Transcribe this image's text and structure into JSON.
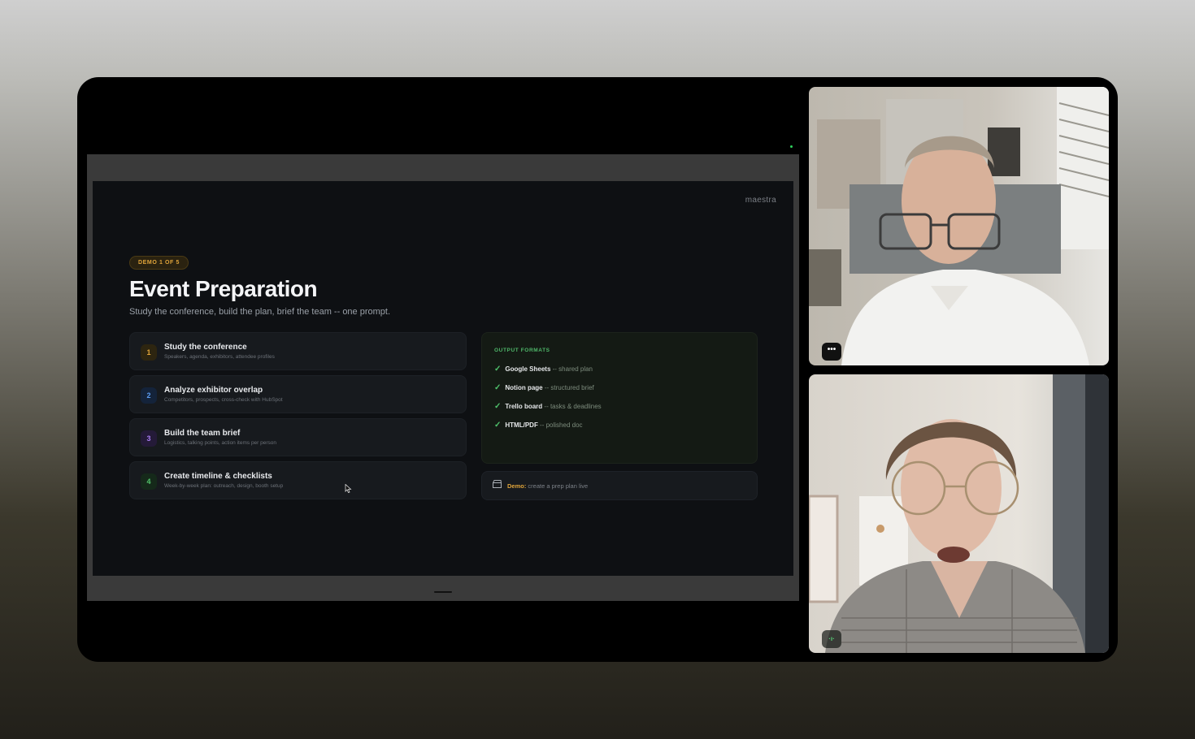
{
  "slide": {
    "brand": "maestra",
    "badge": "DEMO 1 OF 5",
    "title": "Event Preparation",
    "subtitle": "Study the conference, build the plan, brief the team -- one prompt.",
    "steps": [
      {
        "num": "1",
        "title": "Study the conference",
        "desc": "Speakers, agenda, exhibitors, attendee profiles"
      },
      {
        "num": "2",
        "title": "Analyze exhibitor overlap",
        "desc": "Competitors, prospects, cross-check with HubSpot"
      },
      {
        "num": "3",
        "title": "Build the team brief",
        "desc": "Logistics, talking points, action items per person"
      },
      {
        "num": "4",
        "title": "Create timeline & checklists",
        "desc": "Week-by-week plan: outreach, design, booth setup"
      }
    ],
    "output": {
      "heading": "OUTPUT FORMATS",
      "items": [
        {
          "name": "Google Sheets",
          "desc": " -- shared plan"
        },
        {
          "name": "Notion page",
          "desc": " -- structured brief"
        },
        {
          "name": "Trello board",
          "desc": " -- tasks & deadlines"
        },
        {
          "name": "HTML/PDF",
          "desc": " -- polished doc"
        }
      ]
    },
    "demo": {
      "label": "Demo:",
      "text": " create a prep plan live"
    }
  },
  "tiles": {
    "more_glyph": "•••",
    "audio_glyph": "·ı·"
  },
  "colors": {
    "accent_amber": "#e0a43a",
    "accent_green": "#4fc26b",
    "slide_bg": "#0e1013"
  },
  "icons": [
    "clapperboard-icon",
    "check-icon",
    "more-options-icon",
    "audio-level-icon",
    "mouse-cursor-icon"
  ]
}
